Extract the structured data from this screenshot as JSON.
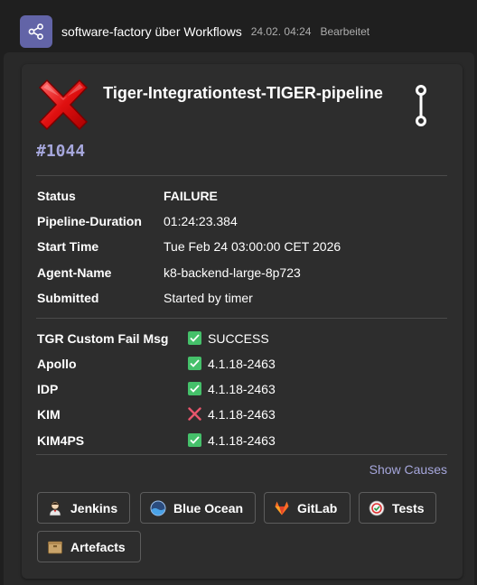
{
  "header": {
    "sender": "software-factory über Workflows",
    "timestamp": "24.02. 04:24",
    "edited": "Bearbeitet",
    "app_icon": "workflow-share-icon",
    "accent": "#6264a7"
  },
  "card": {
    "title": "Tiger-Integrationtest-TIGER-pipeline",
    "status_icon": "red-x-icon",
    "build_number": "#1044",
    "facts": [
      {
        "key": "Status",
        "value": "FAILURE"
      },
      {
        "key": "Pipeline-Duration",
        "value": "01:24:23.384"
      },
      {
        "key": "Start Time",
        "value": "Tue Feb 24 03:00:00 CET 2026"
      },
      {
        "key": "Agent-Name",
        "value": "k8-backend-large-8p723"
      },
      {
        "key": "Submitted",
        "value": "Started by timer"
      }
    ],
    "results": [
      {
        "key": "TGR Custom Fail Msg",
        "icon": "check-icon",
        "value": "SUCCESS"
      },
      {
        "key": "Apollo",
        "icon": "check-icon",
        "value": "4.1.18-2463"
      },
      {
        "key": "IDP",
        "icon": "check-icon",
        "value": "4.1.18-2463"
      },
      {
        "key": "KIM",
        "icon": "cross-icon",
        "value": "4.1.18-2463"
      },
      {
        "key": "KIM4PS",
        "icon": "check-icon",
        "value": "4.1.18-2463"
      }
    ],
    "show_causes": "Show Causes",
    "actions": [
      {
        "label": "Jenkins",
        "icon": "jenkins-icon"
      },
      {
        "label": "Blue Ocean",
        "icon": "blue-ocean-icon"
      },
      {
        "label": "GitLab",
        "icon": "gitlab-icon"
      },
      {
        "label": "Tests",
        "icon": "tests-icon"
      },
      {
        "label": "Artefacts",
        "icon": "artefacts-icon"
      }
    ],
    "colors": {
      "success": "#45c06a",
      "failure": "#e8566c",
      "link": "#a6a7dc"
    }
  }
}
